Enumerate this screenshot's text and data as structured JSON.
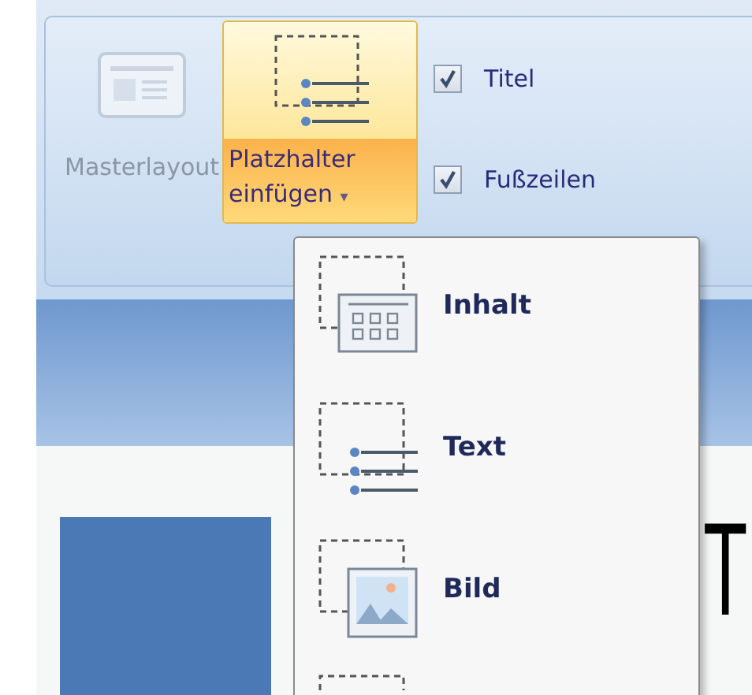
{
  "ribbon": {
    "master_layout": {
      "label": "Masterlayout",
      "disabled": true
    },
    "insert_placeholder": {
      "label_line_1": "Platzhalter",
      "label_line_2": "einfügen",
      "caret": "▾",
      "selected": true
    },
    "checkboxes": [
      {
        "label": "Titel",
        "checked": true
      },
      {
        "label": "Fußzeilen",
        "checked": true
      }
    ]
  },
  "menu": {
    "items": [
      {
        "kind": "content",
        "label": "Inhalt"
      },
      {
        "kind": "text",
        "label": "Text"
      },
      {
        "kind": "picture",
        "label": "Bild"
      },
      {
        "kind": "partial"
      }
    ]
  },
  "slide": {
    "title_fragment": "T"
  }
}
